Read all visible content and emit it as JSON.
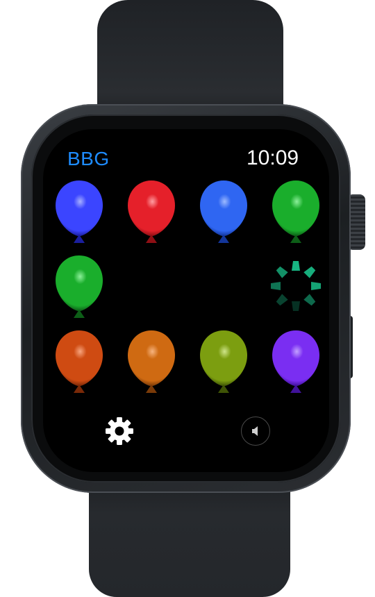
{
  "app": {
    "title": "BBG",
    "time": "10:09"
  },
  "colors": {
    "title_accent": "#1e8cff",
    "spinner": "#19c08a"
  },
  "balloons": [
    {
      "name": "balloon-blue",
      "color": "#3b45ff",
      "dark": "#1b1f9e",
      "light": "#a7b0ff"
    },
    {
      "name": "balloon-red",
      "color": "#e5202a",
      "dark": "#8e0f14",
      "light": "#ff9ea2"
    },
    {
      "name": "balloon-blue-2",
      "color": "#2f66f2",
      "dark": "#13359a",
      "light": "#9dbaff"
    },
    {
      "name": "balloon-green",
      "color": "#1aae2c",
      "dark": "#0d5e17",
      "light": "#8cf09a"
    },
    {
      "name": "balloon-green-2",
      "color": "#1aae2c",
      "dark": "#0d5e17",
      "light": "#8cf09a"
    },
    {
      "name": "balloon-orange-red",
      "color": "#cf4b12",
      "dark": "#7a2908",
      "light": "#f7a57f"
    },
    {
      "name": "balloon-orange",
      "color": "#cf6a12",
      "dark": "#7a3a08",
      "light": "#f7b47f"
    },
    {
      "name": "balloon-olive",
      "color": "#7c9e10",
      "dark": "#3f5406",
      "light": "#cfe58a"
    },
    {
      "name": "balloon-purple",
      "color": "#7a2ef2",
      "dark": "#40129a",
      "light": "#c3a1ff"
    }
  ],
  "icons": {
    "settings": "gear-icon",
    "sound": "speaker-muted-icon",
    "loading": "loading-spinner-icon"
  }
}
